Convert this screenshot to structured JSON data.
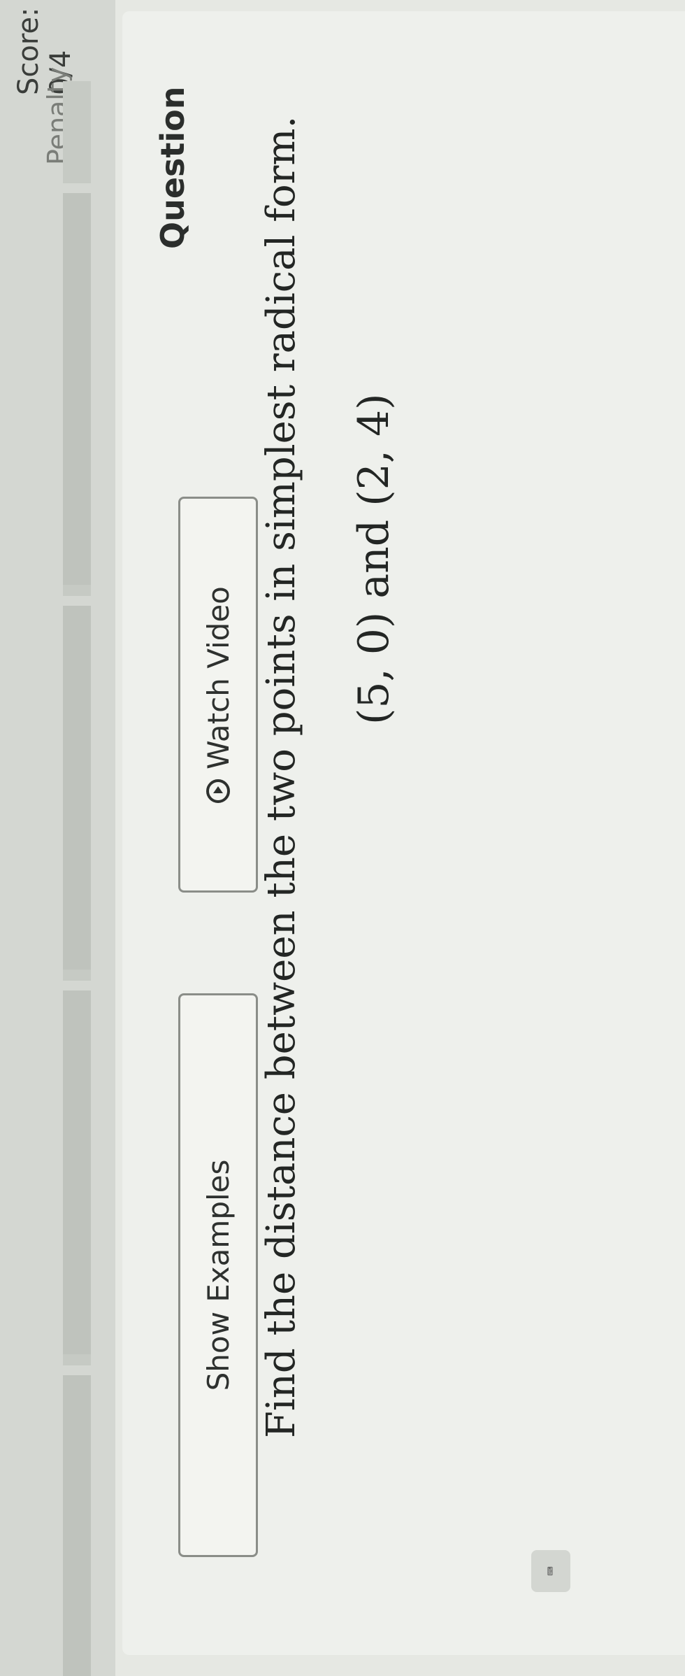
{
  "header": {
    "score_label": "Score: 0/4",
    "cut_label": "Penalty"
  },
  "progress": {
    "completed_fraction": 0
  },
  "question": {
    "heading": "Question",
    "prompt": "Find the distance between the two points in simplest radical form.",
    "points": "(5, 0) and (2, 4)"
  },
  "buttons": {
    "watch_video": "Watch Video",
    "show_examples": "Show Examples"
  },
  "icons": {
    "video": "play-circle-icon",
    "keyboard": "keyboard-icon"
  }
}
